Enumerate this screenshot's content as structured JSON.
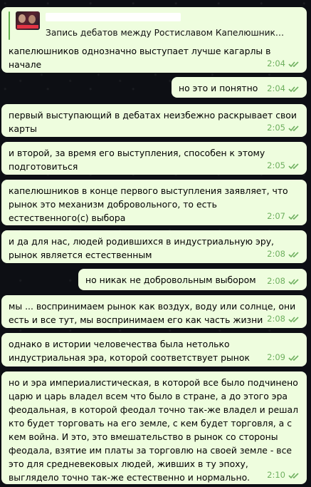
{
  "messages": [
    {
      "reply": {
        "preview": "Запись дебатов между Ростиславом Капелюшниковы..."
      },
      "text": "капелюшников однозначно выступает лучше кагарлы в начале",
      "time": "2:04",
      "side": "left"
    },
    {
      "text": "но это и понятно",
      "time": "2:04",
      "side": "right"
    },
    {
      "text": "первый выступающий в дебатах неизбежно раскрывает свои карты",
      "time": "2:05",
      "side": "left"
    },
    {
      "text": "и второй, за время его выступления, способен к этому подготовиться",
      "time": "2:05",
      "side": "left"
    },
    {
      "text": "капелюшников в конце первого выступления заявляет, что рынок это механизм добровольного, то есть естественного(с) выбора",
      "time": "2:07",
      "side": "left"
    },
    {
      "text": "и да для нас, людей родившихся в индустриальную эру, рынок является естественным",
      "time": "2:08",
      "side": "left"
    },
    {
      "text": "но никак не добровольным выбором",
      "time": "2:08",
      "side": "right"
    },
    {
      "text": "мы ... воспринимаем рынок как воздух, воду или солнце, они есть и все тут, мы воспринимаем его как часть жизни",
      "time": "2:08",
      "side": "left"
    },
    {
      "text": "однако в истории человечества была нетолько индустриальная эра, которой соответствует рынок",
      "time": "2:09",
      "side": "left"
    },
    {
      "text": "но и эра империалистическая, в которой все было подчинено царю и царь владел всем что было в стране, а до этого эра феодальная, в которой феодал точно так-же владел и решал кто будет торговать на его земле, с кем будет торговля, а с кем война. И это, это вмешательство в рынок со стороны феодала, взятие им платы за торговлю на своей земле - все это для средневековых людей, живших в ту эпоху, выглядело точно так-же естественно и нормально.",
      "time": "2:10",
      "side": "left"
    }
  ],
  "colors": {
    "bubble": "#eefdde",
    "time": "#6fb05f",
    "reply_bar": "#62b04f"
  },
  "icons": {
    "status": "double-check-icon"
  }
}
